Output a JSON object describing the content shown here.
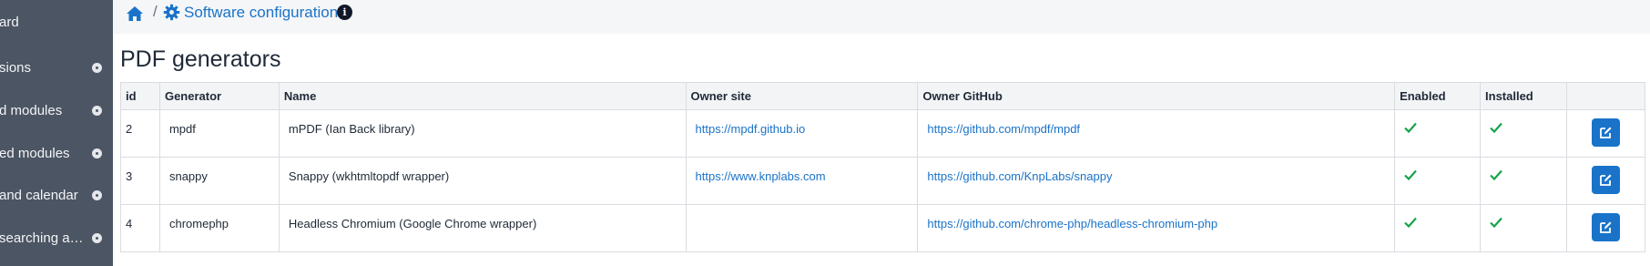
{
  "sidebar": {
    "items": [
      {
        "label": "ard",
        "has_dot": false
      },
      {
        "label": "sions",
        "has_dot": true
      },
      {
        "label": "d modules",
        "has_dot": true
      },
      {
        "label": "ed modules",
        "has_dot": true
      },
      {
        "label": "and calendar",
        "has_dot": true
      },
      {
        "label": "searching a…",
        "has_dot": true
      }
    ]
  },
  "breadcrumb": {
    "separator": "/",
    "current": "Software configuration",
    "info_glyph": "i"
  },
  "page": {
    "title": "PDF generators"
  },
  "table": {
    "headers": [
      "id",
      "Generator",
      "Name",
      "Owner site",
      "Owner GitHub",
      "Enabled",
      "Installed",
      ""
    ],
    "rows": [
      {
        "id": "2",
        "generator": "mpdf",
        "name": "mPDF (Ian Back library)",
        "owner_site": "https://mpdf.github.io",
        "owner_github": "https://github.com/mpdf/mpdf",
        "enabled": true,
        "installed": true
      },
      {
        "id": "3",
        "generator": "snappy",
        "name": "Snappy (wkhtmltopdf wrapper)",
        "owner_site": "https://www.knplabs.com",
        "owner_github": "https://github.com/KnpLabs/snappy",
        "enabled": true,
        "installed": true
      },
      {
        "id": "4",
        "generator": "chromephp",
        "name": "Headless Chromium (Google Chrome wrapper)",
        "owner_site": "",
        "owner_github": "https://github.com/chrome-php/headless-chromium-php",
        "enabled": true,
        "installed": true
      }
    ]
  },
  "colors": {
    "sidebar_bg": "#4b5563",
    "link": "#1a73c9",
    "check": "#16a34a",
    "button": "#1a73c9"
  },
  "icons": {
    "home": "home-icon",
    "gear": "gear-icon",
    "info": "info-icon",
    "check": "check-icon",
    "edit": "edit-icon"
  }
}
